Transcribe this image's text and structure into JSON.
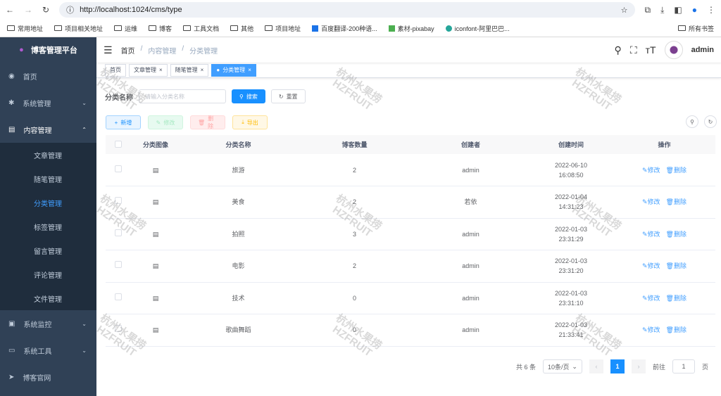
{
  "browser": {
    "url": "http://localhost:1024/cms/type",
    "bookmarks": [
      "常用地址",
      "项目相关地址",
      "运维",
      "博客",
      "工具文档",
      "其他",
      "项目地址",
      "百度翻译-200种语...",
      "素材-pixabay",
      "iconfont-阿里巴巴..."
    ],
    "all_bookmarks": "所有书签"
  },
  "sidebar": {
    "title": "博客管理平台",
    "items": [
      {
        "label": "首页"
      },
      {
        "label": "系统管理"
      },
      {
        "label": "内容管理"
      }
    ],
    "sub": [
      "文章管理",
      "随笔管理",
      "分类管理",
      "标签管理",
      "留言管理",
      "评论管理",
      "文件管理"
    ],
    "bottom": [
      {
        "label": "系统监控"
      },
      {
        "label": "系统工具"
      },
      {
        "label": "博客官网"
      }
    ]
  },
  "header": {
    "crumbs": [
      "首页",
      "内容管理",
      "分类管理"
    ],
    "user": "admin"
  },
  "tags": [
    "首页",
    "文章管理",
    "随笔管理",
    "分类管理"
  ],
  "search": {
    "label": "分类名称",
    "placeholder": "请输入分类名称",
    "search": "搜索",
    "reset": "重置"
  },
  "toolbar": {
    "add": "新增",
    "edit": "修改",
    "delete": "删除",
    "export": "导出"
  },
  "table": {
    "headers": [
      "分类图像",
      "分类名称",
      "博客数量",
      "创建者",
      "创建时间",
      "操作"
    ],
    "rows": [
      {
        "name": "旅游",
        "count": "2",
        "creator": "admin",
        "date": "2022-06-10",
        "time": "16:08:50"
      },
      {
        "name": "美食",
        "count": "2",
        "creator": "若依",
        "date": "2022-01-04",
        "time": "14:31:23"
      },
      {
        "name": "拍照",
        "count": "3",
        "creator": "admin",
        "date": "2022-01-03",
        "time": "23:31:29"
      },
      {
        "name": "电影",
        "count": "2",
        "creator": "admin",
        "date": "2022-01-03",
        "time": "23:31:20"
      },
      {
        "name": "技术",
        "count": "0",
        "creator": "admin",
        "date": "2022-01-03",
        "time": "23:31:10"
      },
      {
        "name": "歌曲舞蹈",
        "count": "0",
        "creator": "admin",
        "date": "2022-01-03",
        "time": "21:33:41"
      }
    ],
    "edit": "修改",
    "delete": "删除"
  },
  "pagination": {
    "total": "共 6 条",
    "size": "10条/页",
    "page": "1",
    "goto": "前往",
    "goto_value": "1",
    "unit": "页"
  },
  "watermark": "杭州水果捞 HZFRUIT"
}
